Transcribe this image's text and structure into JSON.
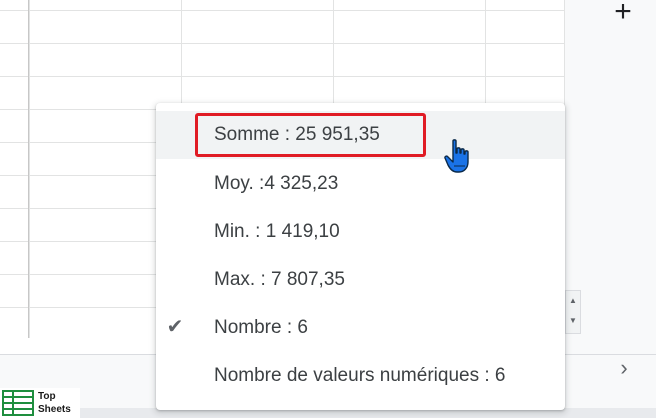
{
  "toolbar": {
    "add_sheet_icon": "plus-icon",
    "next_sheet_icon": "chevron-right-icon"
  },
  "menu": {
    "items": [
      {
        "label": "Somme : 25 951,35",
        "highlighted": true,
        "checked": false
      },
      {
        "label": "Moy. :4 325,23",
        "highlighted": false,
        "checked": false
      },
      {
        "label": "Min. : 1 419,10",
        "highlighted": false,
        "checked": false
      },
      {
        "label": "Max. : 7 807,35",
        "highlighted": false,
        "checked": false
      },
      {
        "label": "Nombre : 6",
        "highlighted": false,
        "checked": true
      },
      {
        "label": "Nombre de valeurs numériques : 6",
        "highlighted": false,
        "checked": false
      }
    ],
    "check_glyph": "✔"
  },
  "logo": {
    "line1": "Top",
    "line2": "Sheets"
  },
  "colors": {
    "highlight_box": "#e01b24",
    "hover_bg": "#f1f3f4",
    "text": "#3c4043",
    "logo_green": "#1e8e3e"
  }
}
